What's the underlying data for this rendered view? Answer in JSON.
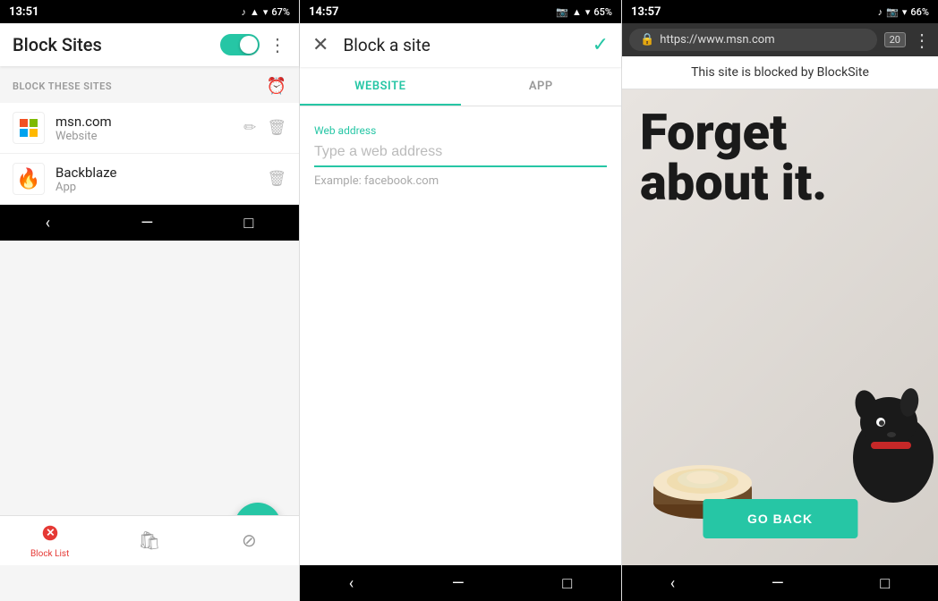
{
  "panel1": {
    "status_bar": {
      "time": "13:51",
      "battery": "67%"
    },
    "title": "Block Sites",
    "section_header": "BLOCK THESE SITES",
    "sites": [
      {
        "name": "msn.com",
        "type": "Website",
        "icon": "msn"
      },
      {
        "name": "Backblaze",
        "type": "App",
        "icon": "backblaze"
      }
    ],
    "bottom_tabs": [
      {
        "label": "Block List",
        "active": true
      },
      {
        "label": ""
      },
      {
        "label": ""
      }
    ],
    "fab_label": "+"
  },
  "panel2": {
    "status_bar": {
      "time": "14:57",
      "battery": "65%"
    },
    "title": "Block a site",
    "tabs": [
      "WEBSITE",
      "APP"
    ],
    "active_tab": 0,
    "field_label": "Web address",
    "field_placeholder": "Type a web address",
    "example_text": "Example: facebook.com"
  },
  "panel3": {
    "status_bar": {
      "time": "13:57",
      "battery": "66%"
    },
    "url": "https://www.msn.com",
    "blocked_notice": "This site is blocked by BlockSite",
    "forget_line1": "Forget",
    "forget_line2": "about it.",
    "go_back_label": "GO BACK"
  }
}
